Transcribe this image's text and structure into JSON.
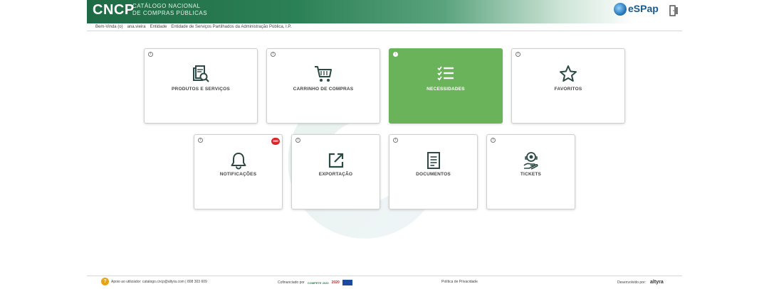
{
  "header": {
    "logo": "CNCP",
    "subtitle_line1": "CATÁLOGO NACIONAL",
    "subtitle_line2": "DE COMPRAS PÚBLICAS",
    "partner_logo": "eSPap",
    "logout_icon": "logout-icon"
  },
  "userbar": {
    "welcome": "Bem-Vinda (o)",
    "username": "ana.vieira",
    "entity_label": "Entidade",
    "entity_name": "Entidade de Serviços Partilhados da Administração Pública, I.P."
  },
  "cards": [
    {
      "label": "PRODUTOS E SERVIÇOS",
      "icon": "catalog-search-icon",
      "active": false
    },
    {
      "label": "CARRINHO DE COMPRAS",
      "icon": "shopping-cart-icon",
      "active": false
    },
    {
      "label": "NECESSIDADES",
      "icon": "checklist-icon",
      "active": true
    },
    {
      "label": "FAVORITOS",
      "icon": "star-icon",
      "active": false
    },
    {
      "label": "NOTIFICAÇÕES",
      "icon": "bell-icon",
      "active": false,
      "badge": "340"
    },
    {
      "label": "EXPORTAÇÃO",
      "icon": "export-icon",
      "active": false
    },
    {
      "label": "DOCUMENTOS",
      "icon": "document-icon",
      "active": false
    },
    {
      "label": "TICKETS",
      "icon": "support-ticket-icon",
      "active": false
    }
  ],
  "footer": {
    "support_text": "Apoio ao utilizador: catalogo.cncp@altyra.com | 808 303 609",
    "cofinanced_label": "Cofinanciado por",
    "compete_logo": "COMPETE 2020",
    "portugal_logo": "2020",
    "privacy": "Política de Privacidade",
    "developed_by_label": "Desenvolvido por:",
    "developer": "altyra"
  },
  "colors": {
    "header_green": "#1e6a45",
    "active_card": "#6bb35a",
    "icon_dark": "#2b4a45",
    "badge_red": "#d9262a"
  }
}
